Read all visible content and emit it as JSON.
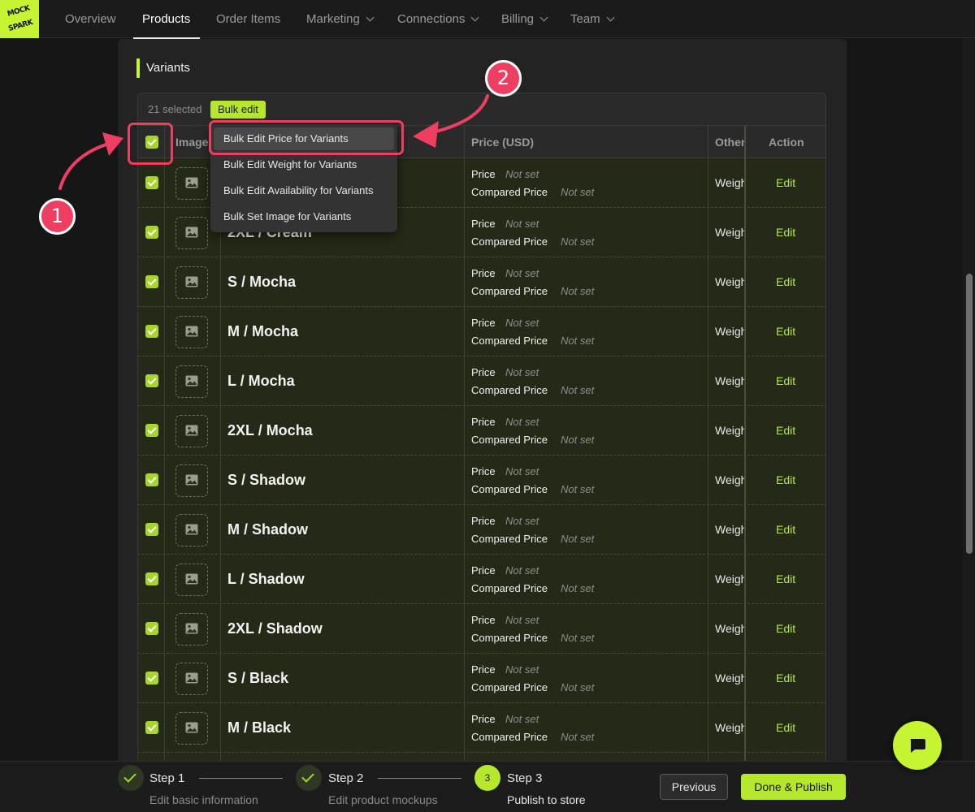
{
  "logo": {
    "text_line1": "MOCK",
    "text_line2": "SPARK"
  },
  "nav": {
    "items": [
      {
        "label": "Overview",
        "active": false,
        "dropdown": false
      },
      {
        "label": "Products",
        "active": true,
        "dropdown": false
      },
      {
        "label": "Order Items",
        "active": false,
        "dropdown": false
      },
      {
        "label": "Marketing",
        "active": false,
        "dropdown": true
      },
      {
        "label": "Connections",
        "active": false,
        "dropdown": true
      },
      {
        "label": "Billing",
        "active": false,
        "dropdown": true
      },
      {
        "label": "Team",
        "active": false,
        "dropdown": true
      }
    ]
  },
  "section": {
    "title": "Variants"
  },
  "selection": {
    "count_text": "21 selected",
    "bulk_edit_label": "Bulk edit"
  },
  "table": {
    "headers": {
      "image": "Image",
      "price": "Price (USD)",
      "other": "Other",
      "action": "Action"
    },
    "rows": [
      {
        "name": ""
      },
      {
        "name": "2XL / Cream"
      },
      {
        "name": "S / Mocha"
      },
      {
        "name": "M / Mocha"
      },
      {
        "name": "L / Mocha"
      },
      {
        "name": "2XL / Mocha"
      },
      {
        "name": "S / Shadow"
      },
      {
        "name": "M / Shadow"
      },
      {
        "name": "L / Shadow"
      },
      {
        "name": "2XL / Shadow"
      },
      {
        "name": "S / Black"
      },
      {
        "name": "M / Black"
      }
    ],
    "price_label": "Price",
    "compared_price_label": "Compared Price",
    "not_set": "Not set",
    "other_value": "Weigh",
    "edit_label": "Edit"
  },
  "dropdown": {
    "items": [
      "Bulk Edit Price for Variants",
      "Bulk Edit Weight for Variants",
      "Bulk Edit Availability for Variants",
      "Bulk Set Image for Variants"
    ]
  },
  "annotations": {
    "badge1": "1",
    "badge2": "2",
    "color": "#ee3f63"
  },
  "steps": [
    {
      "number": "1",
      "title": "Step 1",
      "description": "Edit basic information",
      "state": "done"
    },
    {
      "number": "2",
      "title": "Step 2",
      "description": "Edit product mockups",
      "state": "done"
    },
    {
      "number": "3",
      "title": "Step 3",
      "description": "Publish to store",
      "state": "current"
    }
  ],
  "footer": {
    "previous_label": "Previous",
    "done_label": "Done & Publish"
  },
  "colors": {
    "accent": "#c6f432",
    "selected_row": "#242a17",
    "annotation": "#ee3f63"
  },
  "icons": {
    "chat": "chat-bubble-icon",
    "image_placeholder": "image-icon",
    "checkbox": "checkbox-checked-icon"
  }
}
